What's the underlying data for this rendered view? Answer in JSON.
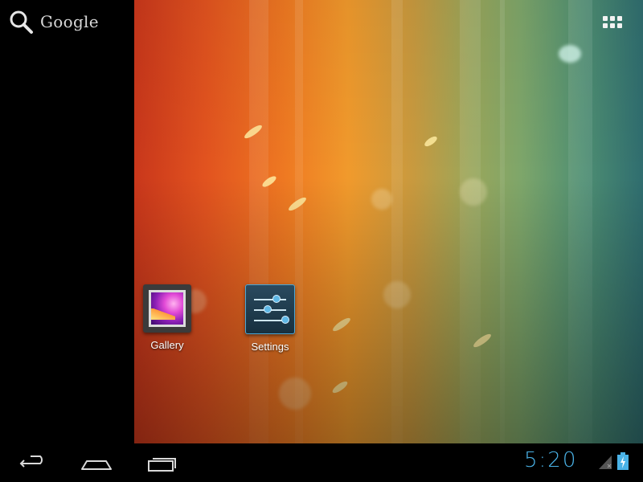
{
  "search": {
    "label": "Google",
    "icon": "search-icon"
  },
  "apps_button": {
    "icon": "all-apps-grid-icon"
  },
  "desktop": {
    "shortcuts": [
      {
        "label": "Gallery",
        "icon": "gallery-icon"
      },
      {
        "label": "Settings",
        "icon": "settings-icon"
      }
    ]
  },
  "navbar": {
    "buttons": [
      {
        "icon": "back-icon"
      },
      {
        "icon": "home-icon"
      },
      {
        "icon": "recent-apps-icon"
      }
    ]
  },
  "status": {
    "time": "5:20",
    "signal_icon": "no-signal-icon",
    "battery_icon": "battery-charging-icon",
    "accent": "#4ab3e8"
  }
}
